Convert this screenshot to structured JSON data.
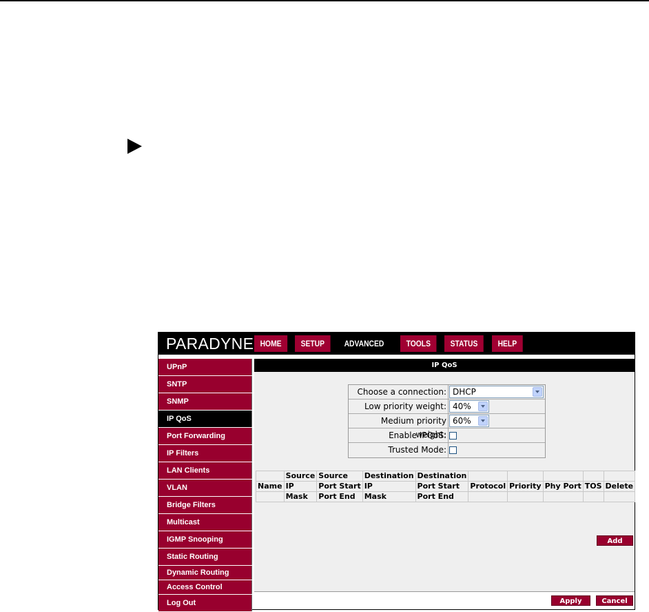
{
  "app": {
    "brand": "PARADYNE",
    "nav": [
      {
        "label": "HOME",
        "active": false
      },
      {
        "label": "SETUP",
        "active": false
      },
      {
        "label": "ADVANCED",
        "active": true
      },
      {
        "label": "TOOLS",
        "active": false
      },
      {
        "label": "STATUS",
        "active": false
      },
      {
        "label": "HELP",
        "active": false
      }
    ],
    "sidebar": [
      {
        "label": "UPnP",
        "active": false
      },
      {
        "label": "SNTP",
        "active": false
      },
      {
        "label": "SNMP",
        "active": false
      },
      {
        "label": "IP QoS",
        "active": true
      },
      {
        "label": "Port Forwarding",
        "active": false
      },
      {
        "label": "IP Filters",
        "active": false
      },
      {
        "label": "LAN Clients",
        "active": false
      },
      {
        "label": "VLAN",
        "active": false
      },
      {
        "label": "Bridge Filters",
        "active": false
      },
      {
        "label": "Multicast",
        "active": false
      },
      {
        "label": "IGMP Snooping",
        "active": false
      },
      {
        "label": "Static Routing",
        "active": false
      },
      {
        "label": "Dynamic Routing",
        "active": false
      },
      {
        "label": "Access Control",
        "active": false
      },
      {
        "label": "Log Out",
        "active": false
      }
    ],
    "title": "IP QoS",
    "form": {
      "connection_label": "Choose a connection:",
      "connection_value": "DHCP",
      "low_label": "Low priority weight:",
      "low_value": "40%",
      "medium_label": "Medium priority weight:",
      "medium_value": "60%",
      "enable_label": "Enable IPQoS:",
      "enable_checked": false,
      "trusted_label": "Trusted Mode:",
      "trusted_checked": false
    },
    "table": {
      "row1": [
        "",
        "Source",
        "Source",
        "Destination",
        "Destination",
        "",
        "",
        "",
        "",
        ""
      ],
      "row2": [
        "Name",
        "IP",
        "Port Start",
        "IP",
        "Port Start",
        "Protocol",
        "Priority",
        "Phy Port",
        "TOS",
        "Delete"
      ],
      "row3": [
        "",
        "Mask",
        "Port End",
        "Mask",
        "Port End",
        "",
        "",
        "",
        "",
        ""
      ]
    },
    "buttons": {
      "add": "Add",
      "apply": "Apply",
      "cancel": "Cancel"
    },
    "colors": {
      "brand_red": "#98002e",
      "nav_red": "#a00032",
      "bar_black": "#000000",
      "panel_gray": "#efefef"
    }
  }
}
